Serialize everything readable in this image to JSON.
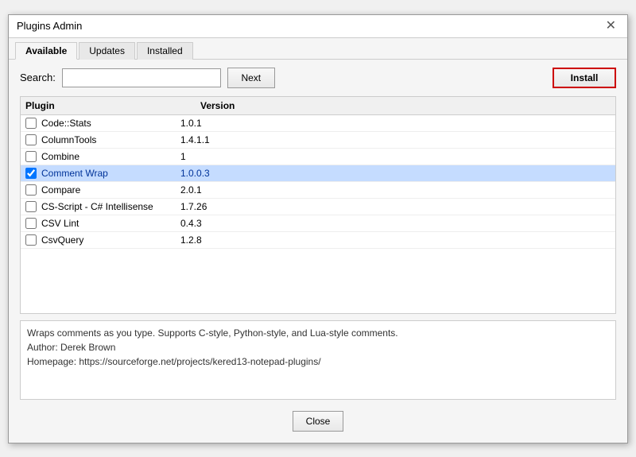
{
  "dialog": {
    "title": "Plugins Admin",
    "close_icon": "✕"
  },
  "tabs": [
    {
      "label": "Available",
      "active": true
    },
    {
      "label": "Updates",
      "active": false
    },
    {
      "label": "Installed",
      "active": false
    }
  ],
  "toolbar": {
    "search_label": "Search:",
    "search_placeholder": "",
    "next_button": "Next",
    "install_button": "Install"
  },
  "table": {
    "col_plugin": "Plugin",
    "col_version": "Version",
    "rows": [
      {
        "name": "Code::Stats",
        "version": "1.0.1",
        "checked": false,
        "selected": false
      },
      {
        "name": "ColumnTools",
        "version": "1.4.1.1",
        "checked": false,
        "selected": false
      },
      {
        "name": "Combine",
        "version": "1",
        "checked": false,
        "selected": false
      },
      {
        "name": "Comment Wrap",
        "version": "1.0.0.3",
        "checked": true,
        "selected": true
      },
      {
        "name": "Compare",
        "version": "2.0.1",
        "checked": false,
        "selected": false
      },
      {
        "name": "CS-Script - C# Intellisense",
        "version": "1.7.26",
        "checked": false,
        "selected": false
      },
      {
        "name": "CSV Lint",
        "version": "0.4.3",
        "checked": false,
        "selected": false
      },
      {
        "name": "CsvQuery",
        "version": "1.2.8",
        "checked": false,
        "selected": false
      }
    ]
  },
  "description": {
    "text": "Wraps comments as you type. Supports C-style, Python-style, and Lua-style comments.\nAuthor: Derek Brown\nHomepage: https://sourceforge.net/projects/kered13-notepad-plugins/"
  },
  "footer": {
    "close_button": "Close"
  }
}
